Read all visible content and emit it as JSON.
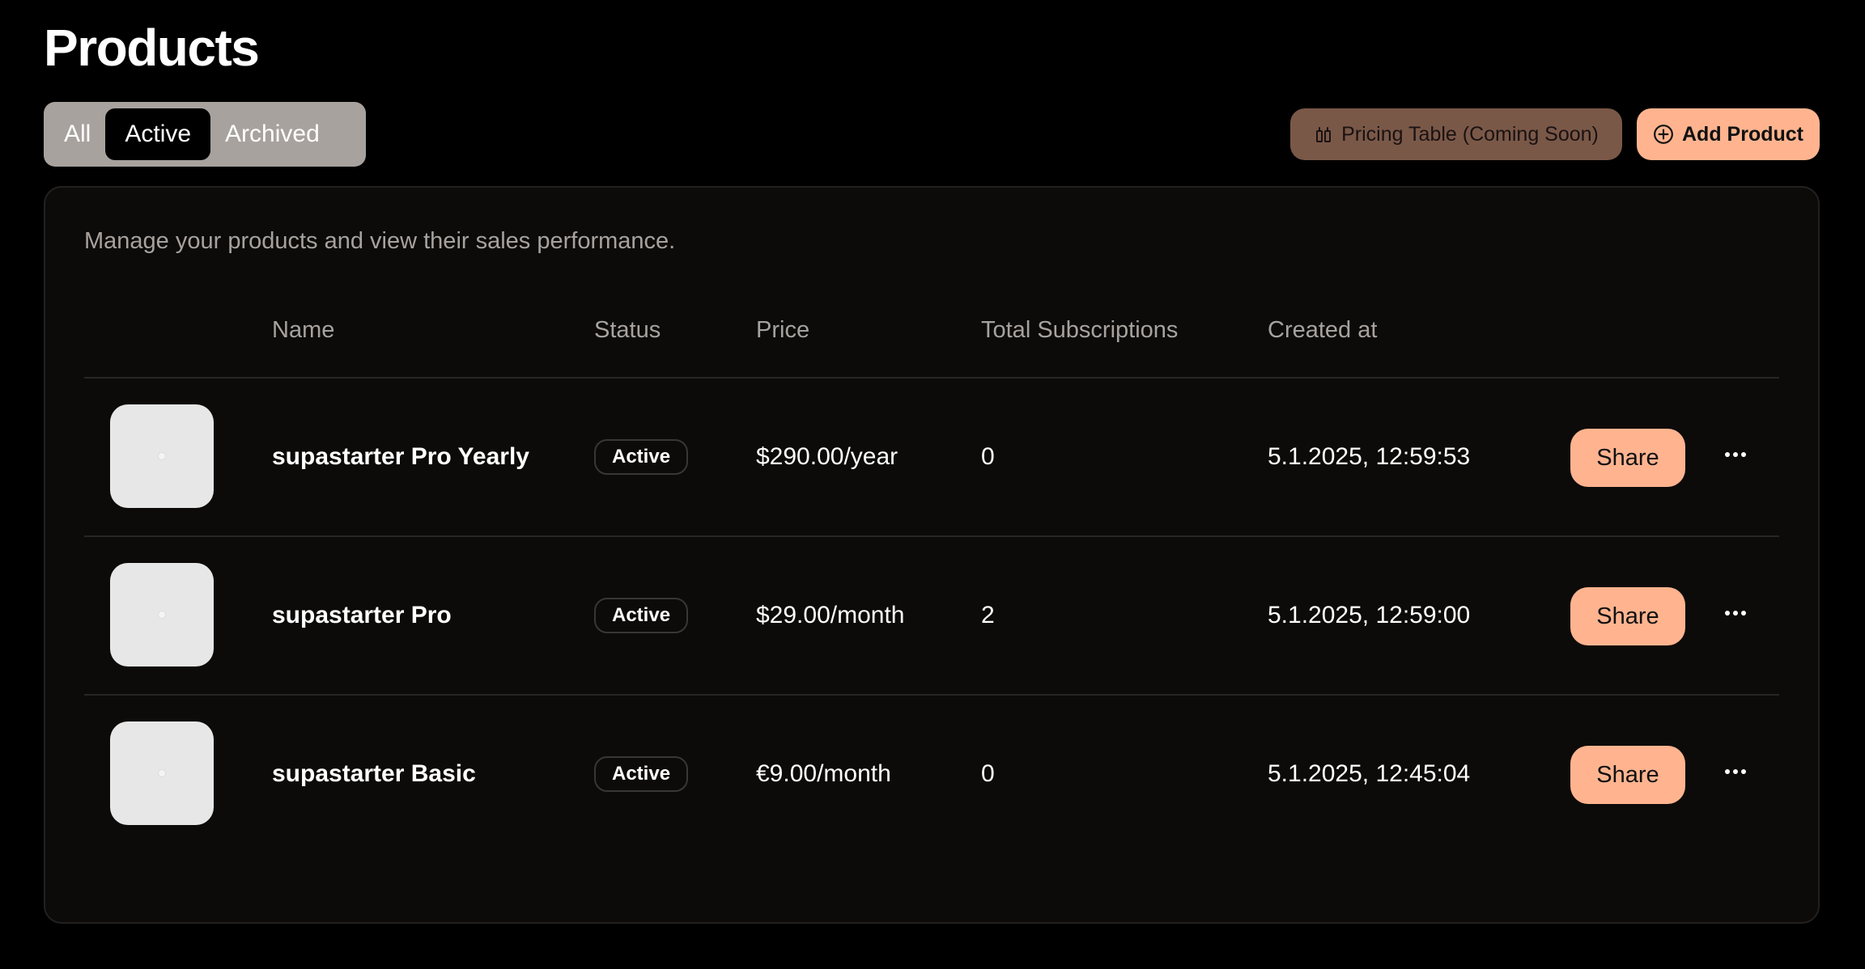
{
  "page": {
    "title": "Products"
  },
  "filters": {
    "tabs": [
      {
        "label": "All",
        "selected": false
      },
      {
        "label": "Active",
        "selected": true
      },
      {
        "label": "Archived",
        "selected": false
      }
    ]
  },
  "header_actions": {
    "pricing_table_label": "Pricing Table (Coming Soon)",
    "pricing_table_icon": "table-columns-icon",
    "add_product_label": "Add Product",
    "add_product_icon": "plus-circle-icon"
  },
  "card": {
    "description": "Manage your products and view their sales performance."
  },
  "table": {
    "columns": [
      "",
      "Name",
      "Status",
      "Price",
      "Total Subscriptions",
      "Created at"
    ],
    "rows": [
      {
        "name": "supastarter Pro Yearly",
        "status": "Active",
        "price": "$290.00/year",
        "total_subscriptions": "0",
        "created_at": "5.1.2025, 12:59:53",
        "share_label": "Share"
      },
      {
        "name": "supastarter Pro",
        "status": "Active",
        "price": "$29.00/month",
        "total_subscriptions": "2",
        "created_at": "5.1.2025, 12:59:00",
        "share_label": "Share"
      },
      {
        "name": "supastarter Basic",
        "status": "Active",
        "price": "€9.00/month",
        "total_subscriptions": "0",
        "created_at": "5.1.2025, 12:45:04",
        "share_label": "Share"
      }
    ]
  },
  "colors": {
    "background": "#000000",
    "card_background": "#0c0b0a",
    "accent": "#ffb48f",
    "pricing_button": "#7a5848",
    "filter_group": "#a8a29e",
    "muted_text": "#a8a29e"
  }
}
